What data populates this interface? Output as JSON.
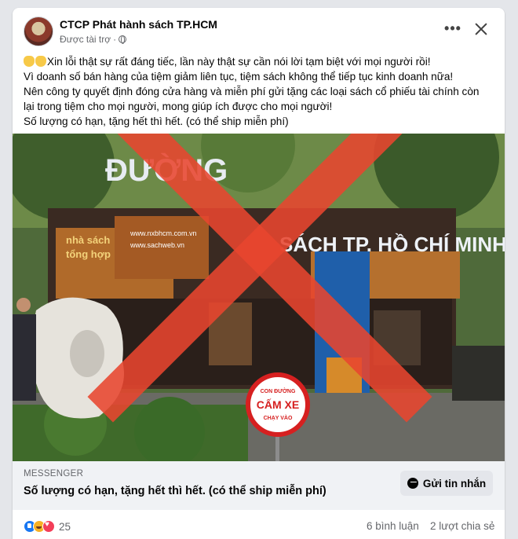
{
  "post": {
    "page_name": "CTCP Phát hành sách TP.HCM",
    "sponsored_label": "Được tài trợ",
    "sponsored_separator": "·",
    "text_lines": [
      "Xin lỗi thật sự rất đáng tiếc, lần này thật sự cần nói lời tạm biệt với mọi người rồi!",
      "Vì doanh số bán hàng của tiệm giảm liên tục, tiệm sách không thể tiếp tục kinh doanh nữa!",
      "Nên công ty quyết định đóng cửa hàng và miễn phí gửi tặng các loại sách cổ phiếu tài chính còn",
      "lại trong tiệm cho mọi người, mong giúp ích được cho mọi người!",
      "Số lượng có hạn, tặng hết thì hết. (có thể ship miễn phí)"
    ],
    "leading_icons": [
      "waving-hand-icon",
      "waving-hand-icon"
    ]
  },
  "photo": {
    "signs": {
      "street_sign_top": "ĐƯỜNG",
      "street_sign_bottom": "SÁCH TP. HỒ CHÍ MINH",
      "shop_sign": "nhà sách",
      "shop_sign_2": "tổng hợp",
      "web_1": "www.nxbhcm.com.vn",
      "web_2": "www.sachweb.vn",
      "road_sign_line1": "CON ĐƯỜNG",
      "road_sign_line2": "CẤM XE",
      "road_sign_line3": "CHẠY VÀO"
    },
    "overlay": "red-x-mark"
  },
  "link": {
    "source": "MESSENGER",
    "title": "Số lượng có hạn, tặng hết thì hết. (có thể ship miễn phí)",
    "button_label": "Gửi tin nhắn"
  },
  "footer": {
    "reaction_count": "25",
    "comments": "6 bình luận",
    "shares": "2 lượt chia sẻ"
  },
  "colors": {
    "x_mark": "#e8452f",
    "messenger_bar": "#f0f2f5",
    "like": "#1877f2",
    "love": "#f33e58",
    "haha": "#f7b125"
  }
}
